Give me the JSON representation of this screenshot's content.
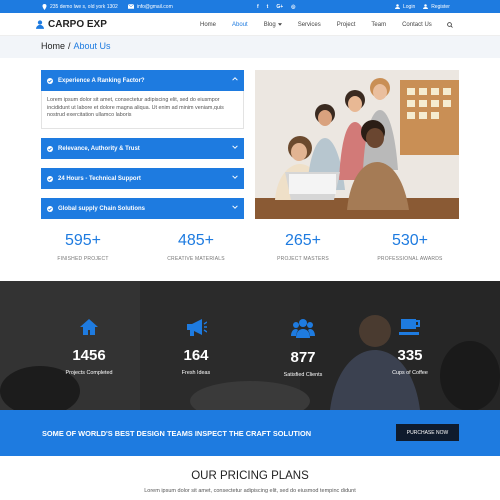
{
  "topbar": {
    "address": "235 demo lwe s, old york 1302",
    "email": "info@gmail.com",
    "social": [
      "f",
      "t",
      "G+",
      "◎"
    ],
    "login": "Login",
    "register": "Register"
  },
  "header": {
    "logo": "CARPO EXP",
    "nav": [
      {
        "label": "Home"
      },
      {
        "label": "About"
      },
      {
        "label": "Blog"
      },
      {
        "label": "Services"
      },
      {
        "label": "Project"
      },
      {
        "label": "Team"
      },
      {
        "label": "Contact Us"
      }
    ]
  },
  "breadcrumb": {
    "home": "Home",
    "separator": "/",
    "current": "About Us"
  },
  "accordion": {
    "items": [
      {
        "title": "Experience A Ranking Factor?",
        "body": "Lorem ipsum dolor sit amet, consectetur adipiscing elit, sed do eiusmpor incididunt ut labore et dolore magna aliqua. Ut enim ad minim veniam,quis nostrud exercitation ullamco laboris"
      },
      {
        "title": "Relevance, Authority & Trust"
      },
      {
        "title": "24 Hours - Technical Support"
      },
      {
        "title": "Global supply Chain Solutions"
      }
    ]
  },
  "counters": [
    {
      "value": "595+",
      "label": "FINISHED PROJECT"
    },
    {
      "value": "485+",
      "label": "CREATIVE MATERIALS"
    },
    {
      "value": "265+",
      "label": "PROJECT MASTERS"
    },
    {
      "value": "530+",
      "label": "PROFESSIONAL AWARDS"
    }
  ],
  "stats": [
    {
      "icon": "home-icon",
      "value": "1456",
      "label": "Projects Completed"
    },
    {
      "icon": "megaphone-icon",
      "value": "164",
      "label": "Fresh Ideas"
    },
    {
      "icon": "users-icon",
      "value": "877",
      "label": "Satisfied Clients"
    },
    {
      "icon": "coffee-icon",
      "value": "335",
      "label": "Cups of Coffee"
    }
  ],
  "cta": {
    "text": "SOME OF WORLD'S BEST DESIGN TEAMS INSPECT THE CRAFT SOLUTION",
    "button": "PURCHASE NOW"
  },
  "pricing": {
    "title": "OUR PRICING PLANS",
    "subtitle": "Lorem ipsum dolor sit amet, consectetur adipiscing elit, sed do eiusmod tempinc didunt"
  },
  "colors": {
    "accent": "#1e7be0",
    "dark": "#0f1b2d"
  }
}
